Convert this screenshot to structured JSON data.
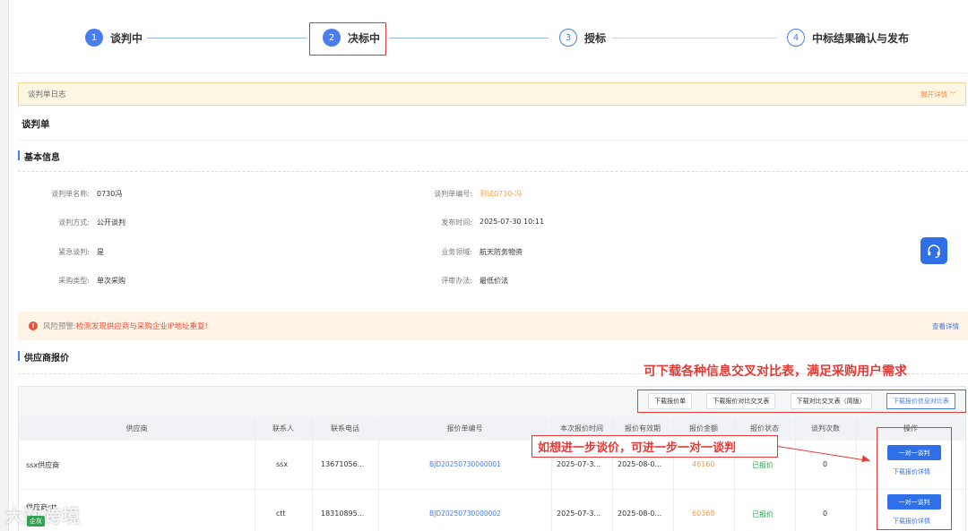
{
  "steps": [
    {
      "num": "1",
      "label": "谈判中",
      "state": "done"
    },
    {
      "num": "2",
      "label": "决标中",
      "state": "current"
    },
    {
      "num": "3",
      "label": "授标",
      "state": "todo"
    },
    {
      "num": "4",
      "label": "中标结果确认与发布",
      "state": "todo"
    }
  ],
  "log": {
    "title": "谈判单日志",
    "expand": "展开详情"
  },
  "page_title": "谈判单",
  "basic": {
    "title": "基本信息",
    "fields": [
      {
        "label": "谈判单名称:",
        "value": "0730冯"
      },
      {
        "label": "谈判单编号:",
        "value": "测试0730-冯"
      },
      {
        "label": "谈判方式:",
        "value": "公开谈判"
      },
      {
        "label": "发布时间:",
        "value": "2025-07-30 10:11"
      },
      {
        "label": "紧急谈判:",
        "value": "是"
      },
      {
        "label": "业务领域:",
        "value": "航天防务物资"
      },
      {
        "label": "采购类型:",
        "value": "单次采购"
      },
      {
        "label": "评审办法:",
        "value": "最低价法"
      }
    ]
  },
  "risk": {
    "label": "风险预警:",
    "message": "检测发现供应商与采购企业IP地址重复!",
    "link": "查看详情"
  },
  "quote": {
    "title": "供应商报价",
    "annotation": "可下载各种信息交叉对比表，满足采购用户需求",
    "buttons": [
      "下载报价单",
      "下载报价对比交叉表",
      "下载对比交叉表（简版）",
      "下载报价信息对比表"
    ],
    "headers": [
      "供应商",
      "联系人",
      "联系电话",
      "报价单编号",
      "本次报价时间",
      "报价有效期",
      "报价金额",
      "报价状态",
      "谈判次数",
      "操作"
    ],
    "rows": [
      {
        "supplier": "ssx供应商",
        "contact": "ssx",
        "phone": "13671056...",
        "code": "BJD20250730000001",
        "time": "2025-07-3...",
        "valid": "2025-08-0...",
        "amount": "46160",
        "status": "已报价",
        "count": "0"
      },
      {
        "supplier": "供应商ctt",
        "contact": "ctt",
        "phone": "18310895...",
        "code": "BJD20250730000002",
        "time": "2025-07-3...",
        "valid": "2025-08-0...",
        "amount": "60368",
        "status": "已报价",
        "count": "0"
      }
    ],
    "op_button": "一对一谈判",
    "op_link": "下载报价详情",
    "callout": "如想进一步谈价，可进一步一对一谈判",
    "badge": "企灰"
  },
  "watermark": "大数跨境"
}
